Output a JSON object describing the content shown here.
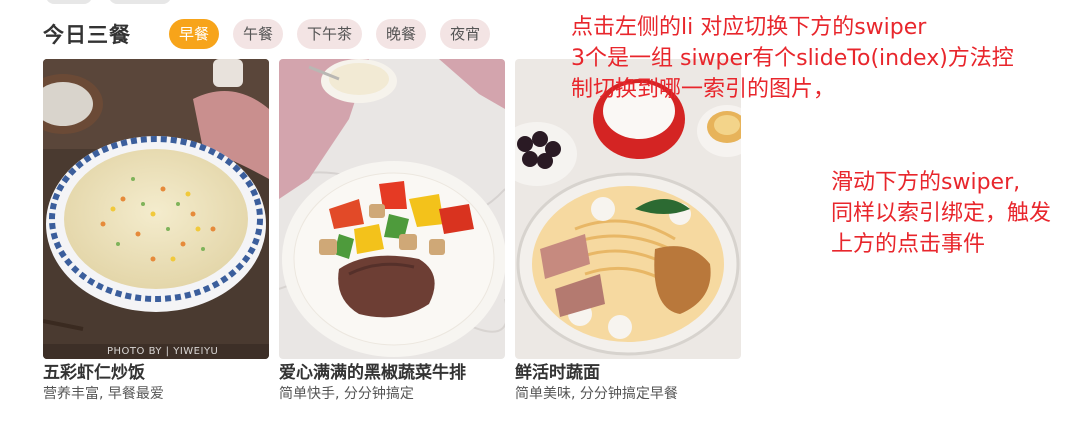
{
  "section": {
    "title": "今日三餐",
    "tabs": [
      {
        "label": "早餐",
        "active": true
      },
      {
        "label": "午餐",
        "active": false
      },
      {
        "label": "下午茶",
        "active": false
      },
      {
        "label": "晚餐",
        "active": false
      },
      {
        "label": "夜宵",
        "active": false
      }
    ],
    "cards": [
      {
        "title": "五彩虾仁炒饭",
        "desc": "营养丰富, 早餐最爱",
        "image": "fried-rice-image",
        "watermark": "PHOTO BY | YIWEIYU"
      },
      {
        "title": "爱心满满的黑椒蔬菜牛排",
        "desc": "简单快手, 分分钟搞定",
        "image": "steak-vegetables-image"
      },
      {
        "title": "鲜活时蔬面",
        "desc": "简单美味, 分分钟搞定早餐",
        "image": "noodle-bowl-image"
      }
    ]
  },
  "annotations": {
    "note1": [
      "点击左侧的li 对应切换下方的swiper",
      "3个是一组 siwper有个slideTo(index)方法控",
      "制切换到哪一索引的图片，"
    ],
    "note2": [
      "滑动下方的swiper,",
      "同样以索引绑定，触发",
      "上方的点击事件"
    ]
  },
  "colors": {
    "active_tab": "#f7a41a",
    "tab_bg": "#f3e4e4",
    "annotation": "#e8262c"
  }
}
